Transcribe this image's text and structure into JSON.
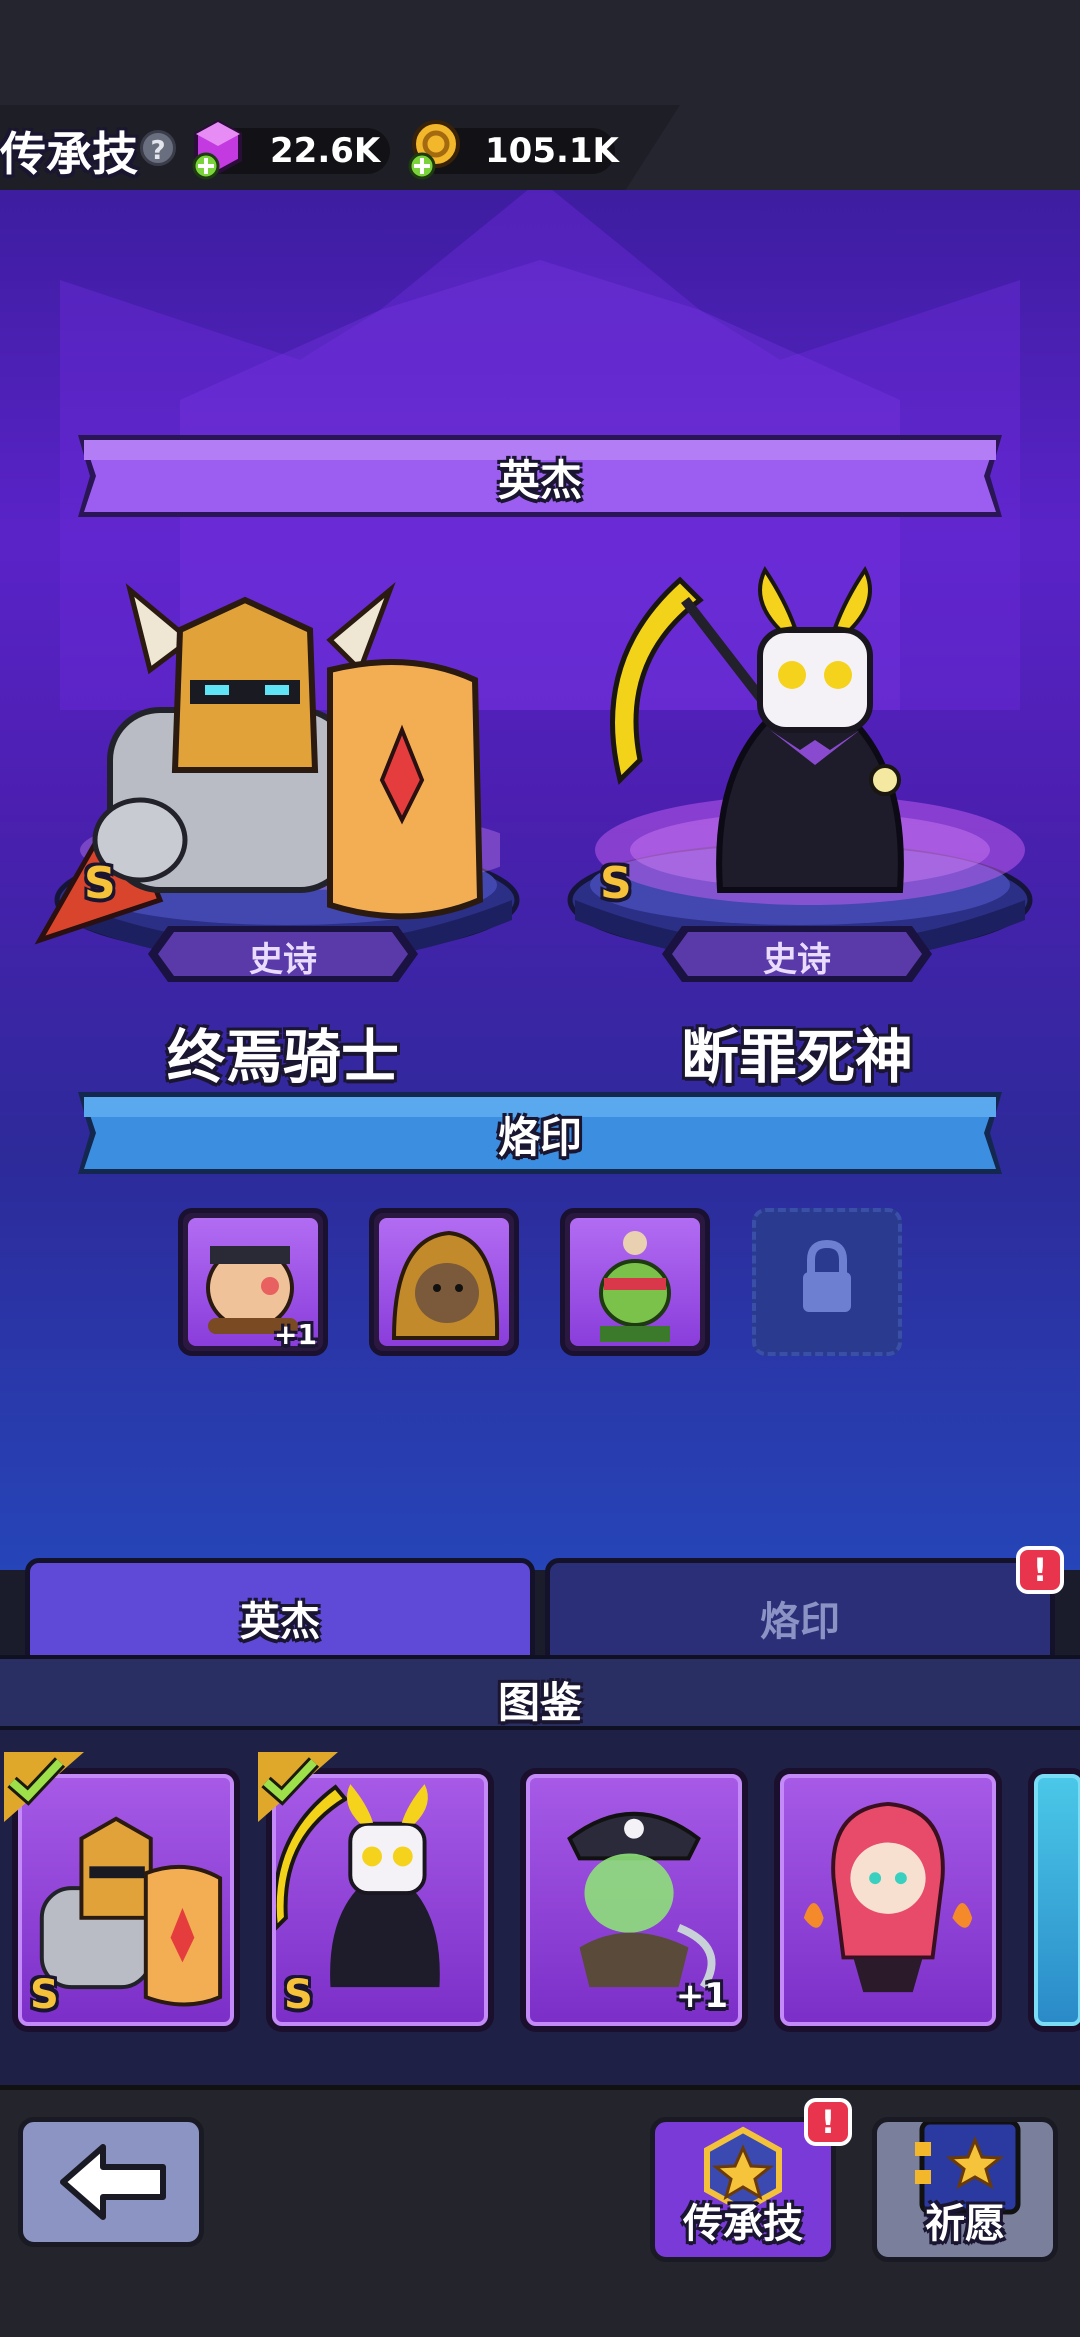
{
  "header": {
    "title": "传承技",
    "help_symbol": "?",
    "gems": "22.6K",
    "gold": "105.1K"
  },
  "stage": {
    "heroes_banner": "英杰",
    "heroes": [
      {
        "name": "终焉骑士",
        "rarity": "史诗",
        "rank": "S"
      },
      {
        "name": "断罪死神",
        "rarity": "史诗",
        "rank": "S"
      }
    ],
    "brand_banner": "烙印",
    "brand_slots": [
      {
        "plus": "+1"
      },
      {
        "plus": ""
      },
      {
        "plus": ""
      }
    ]
  },
  "tabs": [
    {
      "label": "英杰",
      "active": true
    },
    {
      "label": "烙印",
      "active": false,
      "alert": "!"
    }
  ],
  "codex": {
    "title": "图鉴",
    "cards": [
      {
        "rank": "S",
        "owned": true,
        "plus": ""
      },
      {
        "rank": "S",
        "owned": true,
        "plus": ""
      },
      {
        "rank": "",
        "owned": false,
        "plus": "+1"
      },
      {
        "rank": "",
        "owned": false,
        "plus": ""
      }
    ]
  },
  "nav": {
    "legacy_label": "传承技",
    "legacy_alert": "!",
    "wish_label": "祈愿"
  },
  "colors": {
    "banner_purple": "#9b5ef0",
    "banner_blue": "#3c8fe0",
    "rank_gold": "#f6c23a",
    "alert_red": "#e8344d"
  }
}
